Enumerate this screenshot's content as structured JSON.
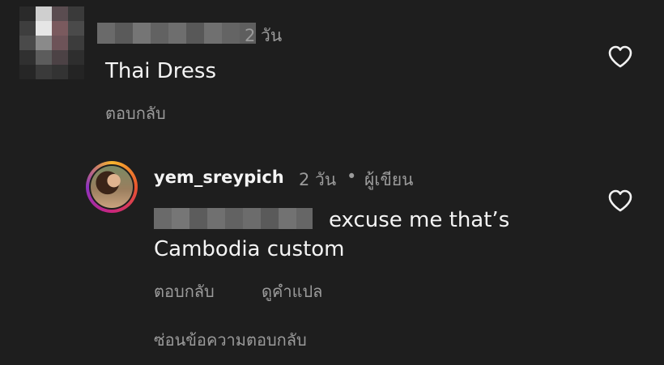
{
  "comment": {
    "time": "2 วัน",
    "text": "Thai Dress",
    "reply_label": "ตอบกลับ"
  },
  "reply": {
    "username": "yem_sreypich",
    "time": "2 วัน",
    "separator": "•",
    "author_badge": "ผู้เขียน",
    "text_line1": "excuse me that’s",
    "text_line2": "Cambodia custom",
    "reply_label": "ตอบกลับ",
    "translate_label": "ดูคำแปล"
  },
  "hide_replies_label": "ซ่อนข้อความตอบกลับ",
  "colors": {
    "background": "#1e1e1e",
    "secondary_text": "#9b9b9b",
    "primary_text": "#f4f4f4"
  }
}
